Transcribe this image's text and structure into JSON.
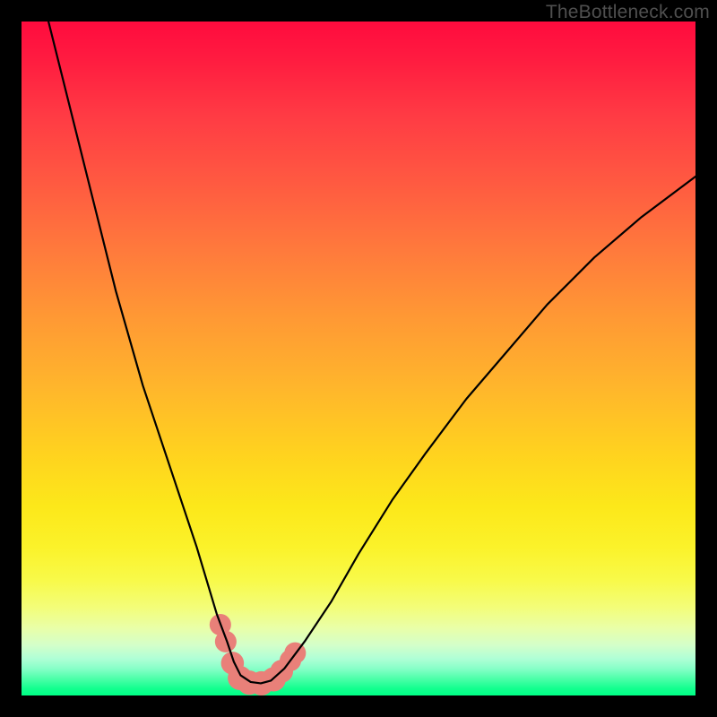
{
  "watermark": {
    "text": "TheBottleneck.com"
  },
  "colors": {
    "frame": "#000000",
    "curve": "#000000",
    "marker_fill": "#e98079",
    "marker_stroke": "#e98079",
    "gradient_top": "#ff0b3e",
    "gradient_bottom": "#00ff86"
  },
  "chart_data": {
    "type": "line",
    "title": "",
    "xlabel": "",
    "ylabel": "",
    "xlim": [
      0,
      100
    ],
    "ylim": [
      0,
      100
    ],
    "grid": false,
    "legend": "none",
    "notes": "No axes, ticks, or labels are rendered. Background is a vertical color gradient (red top → green bottom). A single black curve resembling an asymmetric V with a flat bottom; bottom region decorated with salmon-colored rounded markers.",
    "series": [
      {
        "name": "curve",
        "x": [
          4,
          6,
          8,
          10,
          12,
          14,
          16,
          18,
          20,
          22,
          24,
          26,
          27.5,
          29,
          30.5,
          31.5,
          32.5,
          34,
          35.5,
          37,
          39,
          42,
          46,
          50,
          55,
          60,
          66,
          72,
          78,
          85,
          92,
          100
        ],
        "y": [
          100,
          92,
          84,
          76,
          68,
          60,
          53,
          46,
          40,
          34,
          28,
          22,
          17,
          12,
          8,
          5,
          3,
          2,
          1.8,
          2.2,
          4,
          8,
          14,
          21,
          29,
          36,
          44,
          51,
          58,
          65,
          71,
          77
        ]
      }
    ],
    "markers": [
      {
        "x": 29.5,
        "y": 10.5,
        "r": 1.6
      },
      {
        "x": 30.3,
        "y": 8.0,
        "r": 1.6
      },
      {
        "x": 31.3,
        "y": 4.8,
        "r": 1.7
      },
      {
        "x": 32.4,
        "y": 2.6,
        "r": 1.8
      },
      {
        "x": 33.8,
        "y": 1.9,
        "r": 1.8
      },
      {
        "x": 35.6,
        "y": 1.8,
        "r": 1.8
      },
      {
        "x": 37.4,
        "y": 2.4,
        "r": 1.8
      },
      {
        "x": 38.6,
        "y": 3.6,
        "r": 1.7
      },
      {
        "x": 39.9,
        "y": 5.2,
        "r": 1.6
      },
      {
        "x": 40.6,
        "y": 6.3,
        "r": 1.6
      }
    ]
  }
}
